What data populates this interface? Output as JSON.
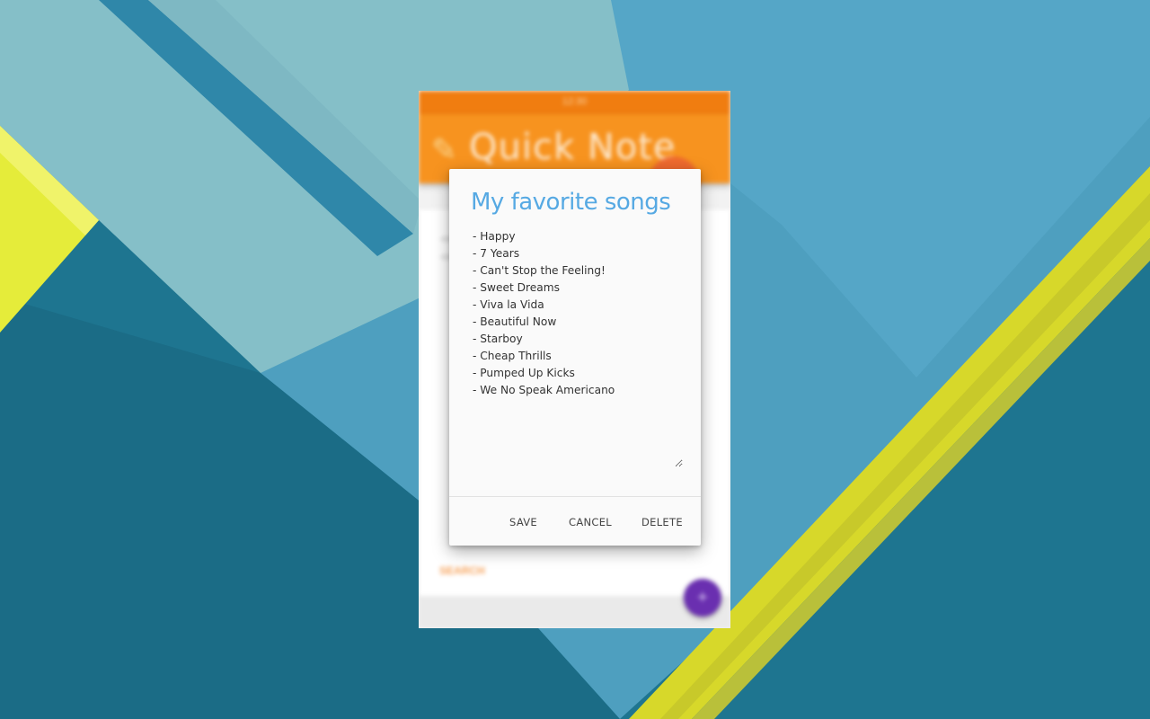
{
  "app": {
    "status_bar_text": "12:30",
    "title": "Quick Note",
    "pencil_icon": "pencil-icon",
    "list_label": "SEARCH",
    "fab_icon": "plus-icon",
    "accent_color": "#f7931f",
    "fab_color": "#6a2fb0"
  },
  "dialog": {
    "title": "My favorite songs",
    "title_color": "#56a9e3",
    "note_text": "- Happy\n- 7 Years\n- Can't Stop the Feeling!\n- Sweet Dreams\n- Viva la Vida\n- Beautiful Now\n- Starboy\n- Cheap Thrills\n- Pumped Up Kicks\n- We No Speak Americano",
    "buttons": {
      "save": "SAVE",
      "cancel": "CANCEL",
      "delete": "DELETE"
    }
  }
}
